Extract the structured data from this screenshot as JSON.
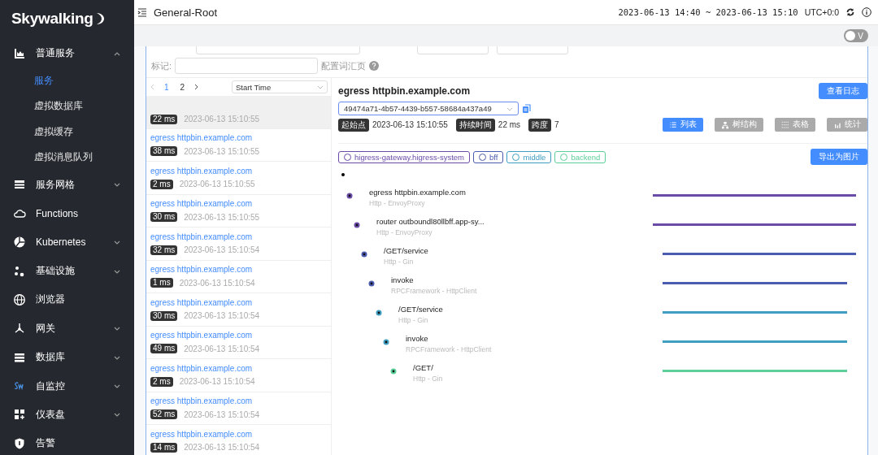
{
  "sidebar": {
    "logo": "Skywalking",
    "items": [
      {
        "label": "普通服务",
        "kind": "group",
        "expanded": true,
        "children": [
          {
            "label": "服务",
            "selected": true
          },
          {
            "label": "虚拟数据库",
            "selected": false
          },
          {
            "label": "虚拟缓存",
            "selected": false
          },
          {
            "label": "虚拟消息队列",
            "selected": false
          }
        ]
      },
      {
        "label": "服务网格",
        "kind": "group",
        "expanded": false
      },
      {
        "label": "Functions",
        "kind": "link"
      },
      {
        "label": "Kubernetes",
        "kind": "group",
        "expanded": false
      },
      {
        "label": "基础设施",
        "kind": "group",
        "expanded": false
      },
      {
        "label": "浏览器",
        "kind": "link"
      },
      {
        "label": "网关",
        "kind": "group",
        "expanded": false
      },
      {
        "label": "数据库",
        "kind": "group",
        "expanded": false
      },
      {
        "label": "自监控",
        "kind": "group",
        "expanded": false
      },
      {
        "label": "仪表盘",
        "kind": "group",
        "expanded": false
      },
      {
        "label": "告警",
        "kind": "link"
      }
    ]
  },
  "header": {
    "title": "General-Root",
    "time_range": "2023-06-13 14:40 ~ 2023-06-13 15:10",
    "timezone": "UTC+0:0"
  },
  "toggle": {
    "label": "V",
    "on": false
  },
  "filters": {
    "tag_label": "标记:",
    "vocabulary_link": "配置词汇页"
  },
  "trace_list": {
    "pages": [
      {
        "label": "1",
        "selected": true
      },
      {
        "label": "2",
        "selected": false
      }
    ],
    "sort": "Start Time",
    "items": [
      {
        "duration": "22 ms",
        "time": "2023-06-13 15:10:55",
        "selected": true
      },
      {
        "title": "egress httpbin.example.com",
        "duration": "38 ms",
        "time": "2023-06-13 15:10:55",
        "selected": false
      },
      {
        "title": "egress httpbin.example.com",
        "duration": "2 ms",
        "time": "2023-06-13 15:10:55",
        "selected": false
      },
      {
        "title": "egress httpbin.example.com",
        "duration": "30 ms",
        "time": "2023-06-13 15:10:55",
        "selected": false
      },
      {
        "title": "egress httpbin.example.com",
        "duration": "32 ms",
        "time": "2023-06-13 15:10:54",
        "selected": false
      },
      {
        "title": "egress httpbin.example.com",
        "duration": "1 ms",
        "time": "2023-06-13 15:10:54",
        "selected": false
      },
      {
        "title": "egress httpbin.example.com",
        "duration": "30 ms",
        "time": "2023-06-13 15:10:54",
        "selected": false
      },
      {
        "title": "egress httpbin.example.com",
        "duration": "49 ms",
        "time": "2023-06-13 15:10:54",
        "selected": false
      },
      {
        "title": "egress httpbin.example.com",
        "duration": "2 ms",
        "time": "2023-06-13 15:10:54",
        "selected": false
      },
      {
        "title": "egress httpbin.example.com",
        "duration": "52 ms",
        "time": "2023-06-13 15:10:54",
        "selected": false
      },
      {
        "title": "egress httpbin.example.com",
        "duration": "14 ms",
        "time": "2023-06-13 15:10:54",
        "selected": false
      }
    ]
  },
  "detail": {
    "title": "egress httpbin.example.com",
    "log_button": "查看日志",
    "trace_id": "49474a71-4b57-4439-b557-58684a437a49",
    "stats": [
      {
        "label": "起始点",
        "value": "2023-06-13 15:10:55"
      },
      {
        "label": "持续时间",
        "value": "22 ms"
      },
      {
        "label": "跨度",
        "value": "7"
      }
    ],
    "views": [
      {
        "label": "列表",
        "selected": true
      },
      {
        "label": "树结构",
        "selected": false
      },
      {
        "label": "表格",
        "selected": false
      },
      {
        "label": "统计",
        "selected": false
      }
    ],
    "services": [
      {
        "name": "higress-gateway.higress-system",
        "color": "#6a4ba8"
      },
      {
        "name": "bff",
        "color": "#4b5bb0"
      },
      {
        "name": "middle",
        "color": "#3f9ec2"
      },
      {
        "name": "backend",
        "color": "#5ccf9a"
      }
    ],
    "export_button": "导出为图片",
    "spans": [
      {
        "name": "egress httpbin.example.com",
        "type": "Http - EnvoyProxy",
        "color": "#6a4ba8",
        "children": [
          {
            "name": "router outboundl80llbff.app-sy...",
            "type": "Http - EnvoyProxy",
            "color": "#6a4ba8",
            "children": [
              {
                "name": "/GET/service",
                "type": "Http - Gin",
                "color": "#4b5bb0",
                "children": [
                  {
                    "name": "invoke",
                    "type": "RPCFramework - HttpClient",
                    "color": "#4b5bb0",
                    "children": [
                      {
                        "name": "/GET/service",
                        "type": "Http - Gin",
                        "color": "#3f9ec2",
                        "children": [
                          {
                            "name": "invoke",
                            "type": "RPCFramework - HttpClient",
                            "color": "#3f9ec2",
                            "children": [
                              {
                                "name": "/GET/",
                                "type": "Http - Gin",
                                "color": "#5ccf9a"
                              }
                            ]
                          }
                        ]
                      }
                    ]
                  }
                ]
              }
            ]
          }
        ]
      }
    ]
  }
}
